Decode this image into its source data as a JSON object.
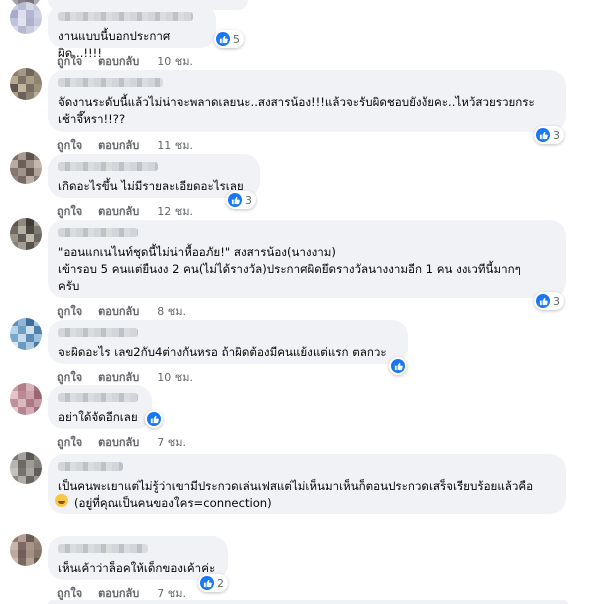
{
  "actions": {
    "like": "ถูกใจ",
    "reply": "ตอบกลับ"
  },
  "accent_color": "#1877f2",
  "comments": [
    {
      "text": "งานแบบนี้บอกประกาศผิด...!!!!",
      "time": "10 ชม.",
      "reactions": "5"
    },
    {
      "text": "จัดงานระดับนี้แล้วไม่น่าจะพลาดเลยนะ..สงสารน้อง!!!แล้วจะรับผิดชอบยังงัยคะ..ไหว้สวยรวยกระ\nเช้าจึ๊หรา!!??",
      "time": "11 ชม.",
      "reactions": "3"
    },
    {
      "text": "เกิดอะไรขึ้น ไม่มีรายละเอียดอะไรเลย",
      "time": "12 ชม.",
      "reactions": "3"
    },
    {
      "text": "\"ออนแกเนไนท์ชุดนี้ไม่น่าหื้ออภัย!\" สงสารน้อง(นางงาม)\nเข้ารอบ 5 คนแต่ยืนงง 2 คน(ไม่ได้รางวัล)ประกาศผิดยึดรางวัลนางงามอีก 1 คน งงเวทีนี้มากๆ\nครับ",
      "time": "8 ชม.",
      "reactions": "3"
    },
    {
      "text": "จะผิดอะไร เลข2กับ4ต่างกันหรอ ถ้าผิดต้องมีคนแย้งแต่แรก ตลกวะ",
      "time": "10 ชม.",
      "reactions": ""
    },
    {
      "text": "อย่าใด้จัดอีกเลย",
      "time": "7 ชม.",
      "reactions": ""
    },
    {
      "text": "เป็นคนพะเยาแต่ไม่รู้ว่าเขามีประกวดเล่นเฟสแต่ไม่เห็นมาเห็นก็ตอนประกวดเสร็จเรียบร้อยแล้วคือ\n(อยู่ที่คุณเป็นคนของใคร=connection)",
      "time": "",
      "reactions": ""
    },
    {
      "text": "เห็นเค้าว่าล็อคให้เด็กของเค้าค่ะ",
      "time": "7 ชม.",
      "reactions": "2"
    }
  ]
}
